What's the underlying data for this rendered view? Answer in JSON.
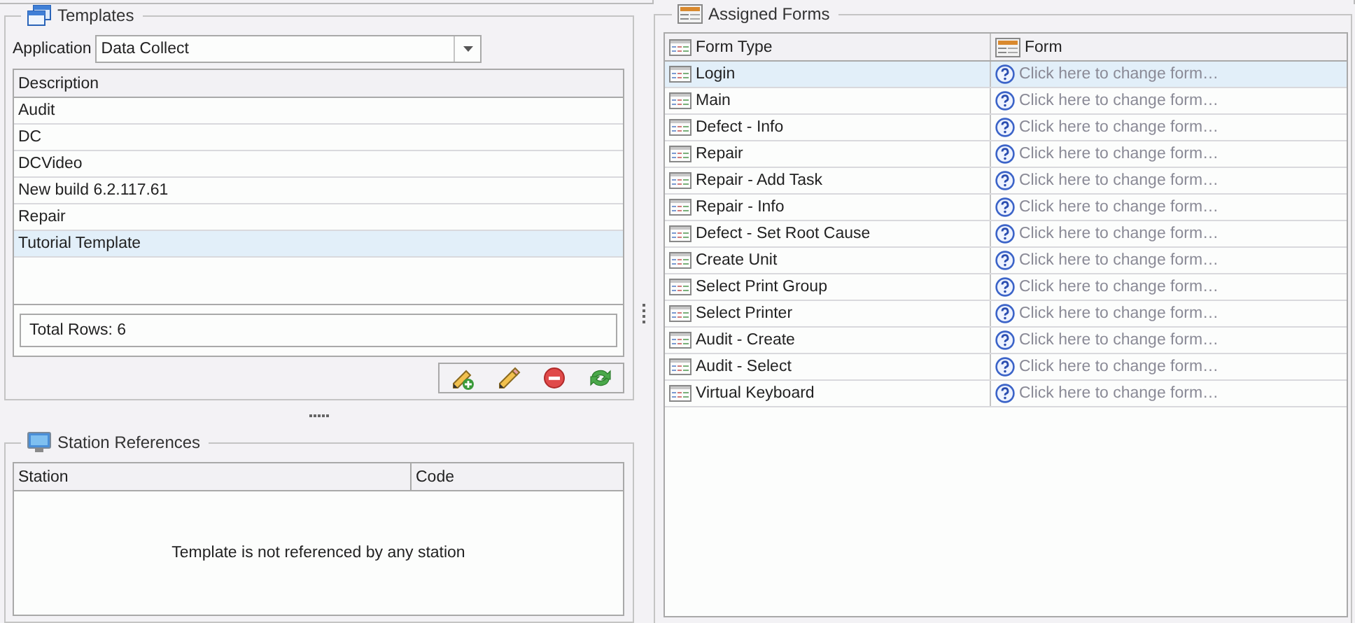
{
  "templates": {
    "title": "Templates",
    "application": {
      "label": "Application",
      "value": "Data Collect"
    },
    "columns": [
      "Description"
    ],
    "rows": [
      {
        "description": "Audit",
        "selected": false
      },
      {
        "description": "DC",
        "selected": false
      },
      {
        "description": "DCVideo",
        "selected": false
      },
      {
        "description": "New build 6.2.117.61",
        "selected": false
      },
      {
        "description": "Repair",
        "selected": false
      },
      {
        "description": "Tutorial Template",
        "selected": true
      }
    ],
    "footer": "Total Rows: 6",
    "toolbar": [
      {
        "kind": "add"
      },
      {
        "kind": "edit"
      },
      {
        "kind": "delete"
      },
      {
        "kind": "refresh"
      }
    ]
  },
  "station_references": {
    "title": "Station References",
    "columns": [
      "Station",
      "Code"
    ],
    "empty_message": "Template is not referenced by any station"
  },
  "assigned_forms": {
    "title": "Assigned Forms",
    "columns": [
      "Form Type",
      "Form"
    ],
    "rows": [
      {
        "form_type": "Login",
        "form": "Click here to change form…",
        "selected": true
      },
      {
        "form_type": "Main",
        "form": "Click here to change form…",
        "selected": false
      },
      {
        "form_type": "Defect - Info",
        "form": "Click here to change form…",
        "selected": false
      },
      {
        "form_type": "Repair",
        "form": "Click here to change form…",
        "selected": false
      },
      {
        "form_type": "Repair - Add Task",
        "form": "Click here to change form…",
        "selected": false
      },
      {
        "form_type": "Repair - Info",
        "form": "Click here to change form…",
        "selected": false
      },
      {
        "form_type": "Defect - Set Root Cause",
        "form": "Click here to change form…",
        "selected": false
      },
      {
        "form_type": "Create Unit",
        "form": "Click here to change form…",
        "selected": false
      },
      {
        "form_type": "Select Print Group",
        "form": "Click here to change form…",
        "selected": false
      },
      {
        "form_type": "Select Printer",
        "form": "Click here to change form…",
        "selected": false
      },
      {
        "form_type": "Audit - Create",
        "form": "Click here to change form…",
        "selected": false
      },
      {
        "form_type": "Audit - Select",
        "form": "Click here to change form…",
        "selected": false
      },
      {
        "form_type": "Virtual Keyboard",
        "form": "Click here to change form…",
        "selected": false
      }
    ]
  }
}
